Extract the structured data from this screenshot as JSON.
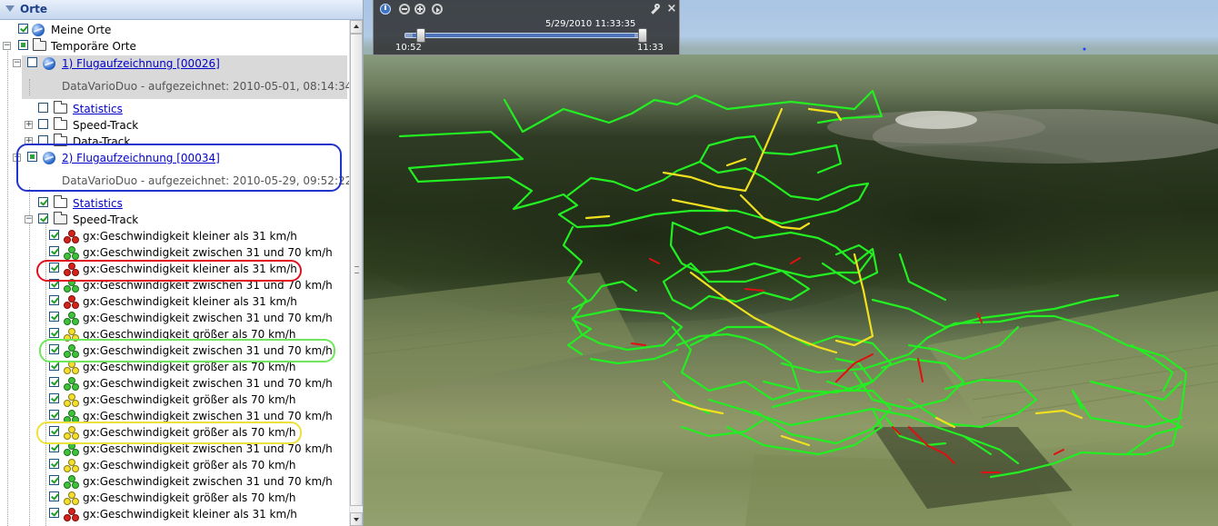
{
  "panel": {
    "title": "Orte"
  },
  "tree": {
    "meine_orte": "Meine Orte",
    "temporaere_orte": "Temporäre Orte",
    "flight1": {
      "title": "1) Flugaufzeichnung [00026]",
      "subtitle": "DataVarioDuo - aufgezeichnet: 2010-05-01, 08:14:34",
      "children": [
        "Statistics",
        "Speed-Track",
        "Data-Track"
      ]
    },
    "flight2": {
      "title": "2) Flugaufzeichnung [00034]",
      "subtitle": "DataVarioDuo - aufgezeichnet: 2010-05-29, 09:52:22",
      "statistics": "Statistics",
      "speed_track": "Speed-Track"
    },
    "segments": [
      {
        "label": "gx:Geschwindigkeit kleiner als 31 km/h",
        "color": "red"
      },
      {
        "label": "gx:Geschwindigkeit zwischen  31 und 70 km/h",
        "color": "green"
      },
      {
        "label": "gx:Geschwindigkeit kleiner als 31 km/h",
        "color": "red"
      },
      {
        "label": "gx:Geschwindigkeit zwischen  31 und 70 km/h",
        "color": "green"
      },
      {
        "label": "gx:Geschwindigkeit kleiner als 31 km/h",
        "color": "red"
      },
      {
        "label": "gx:Geschwindigkeit zwischen  31 und 70 km/h",
        "color": "green"
      },
      {
        "label": "gx:Geschwindigkeit größer als 70 km/h",
        "color": "yellow"
      },
      {
        "label": "gx:Geschwindigkeit zwischen  31 und 70 km/h",
        "color": "green"
      },
      {
        "label": "gx:Geschwindigkeit größer als 70 km/h",
        "color": "yellow"
      },
      {
        "label": "gx:Geschwindigkeit zwischen  31 und 70 km/h",
        "color": "green"
      },
      {
        "label": "gx:Geschwindigkeit größer als 70 km/h",
        "color": "yellow"
      },
      {
        "label": "gx:Geschwindigkeit zwischen  31 und 70 km/h",
        "color": "green"
      },
      {
        "label": "gx:Geschwindigkeit größer als 70 km/h",
        "color": "yellow"
      },
      {
        "label": "gx:Geschwindigkeit zwischen  31 und 70 km/h",
        "color": "green"
      },
      {
        "label": "gx:Geschwindigkeit größer als 70 km/h",
        "color": "yellow"
      },
      {
        "label": "gx:Geschwindigkeit zwischen  31 und 70 km/h",
        "color": "green"
      },
      {
        "label": "gx:Geschwindigkeit größer als 70 km/h",
        "color": "yellow"
      },
      {
        "label": "gx:Geschwindigkeit kleiner als 31 km/h",
        "color": "red"
      }
    ]
  },
  "timeslider": {
    "current_time": "5/29/2010  11:33:35",
    "start_label": "10:52",
    "end_label": "11:33"
  },
  "colors": {
    "track_slow": "#e01010",
    "track_medium": "#22ee22",
    "track_fast": "#f0e020",
    "highlight_selected": "#2233cc",
    "highlight_red": "#e01020",
    "highlight_green": "#6ee85a",
    "highlight_yellow": "#ede13a",
    "link": "#0000cc"
  }
}
